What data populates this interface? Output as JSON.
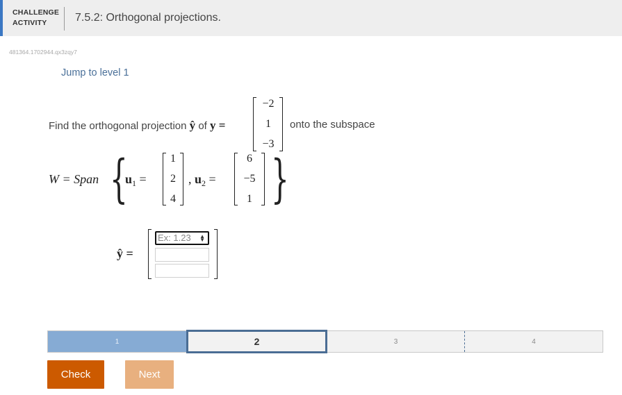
{
  "header": {
    "tag_line1": "CHALLENGE",
    "tag_line2": "ACTIVITY",
    "title": "7.5.2: Orthogonal projections."
  },
  "seed": "481364.1702944.qx3zqy7",
  "jump_link": "Jump to level 1",
  "problem": {
    "prefix": "Find the orthogonal projection",
    "yhat": "ŷ",
    "of": "of",
    "y_eq": "y =",
    "y_vector": [
      "−2",
      "1",
      "−3"
    ],
    "onto": "onto the subspace",
    "w_eq": "W = Span",
    "u1_label": "u",
    "u1_sub": "1",
    "eq": "=",
    "u1_vector": [
      "1",
      "2",
      "4"
    ],
    "comma": ",",
    "u2_label": "u",
    "u2_sub": "2",
    "u2_vector": [
      "6",
      "−5",
      "1"
    ],
    "period": ".",
    "answer_label": "ŷ =",
    "answer_placeholder": "Ex: 1.23"
  },
  "progress": {
    "levels": [
      "1",
      "2",
      "3",
      "4"
    ],
    "current": 2
  },
  "buttons": {
    "check": "Check",
    "next": "Next"
  },
  "colors": {
    "accent": "#3b78c3",
    "check_button": "#cc5a00",
    "next_button": "#e8b07f",
    "progress_done": "#86abd4",
    "progress_current_border": "#4a6d94"
  }
}
